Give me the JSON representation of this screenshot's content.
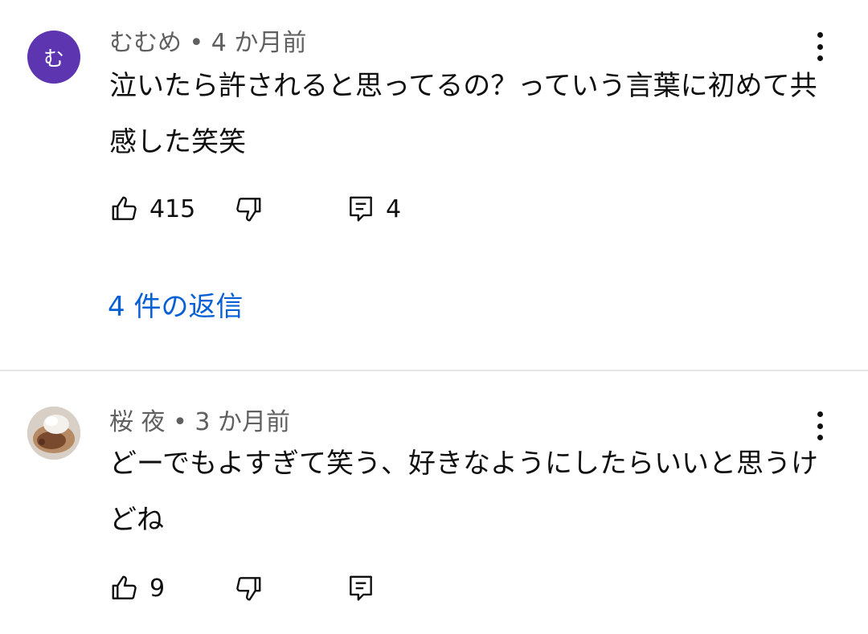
{
  "comments": [
    {
      "avatar_text": "む",
      "avatar_color": "#5e35b1",
      "author": "むむめ",
      "time": "4 か月前",
      "text": "泣いたら許されると思ってるの？っていう言葉に初めて共感した笑笑",
      "likes": "415",
      "replies_count": "4",
      "replies_link": "4 件の返信"
    },
    {
      "author": "桜 夜",
      "time": "3 か月前",
      "text": "どーでもよすぎて笑う、好きなようにしたらいいと思うけどね",
      "likes": "9"
    }
  ],
  "icons": {
    "like": "thumbs-up-icon",
    "dislike": "thumbs-down-icon",
    "reply": "reply-comment-icon",
    "more": "more-vertical-icon"
  },
  "separator": " • ",
  "accent": "#065fd4"
}
